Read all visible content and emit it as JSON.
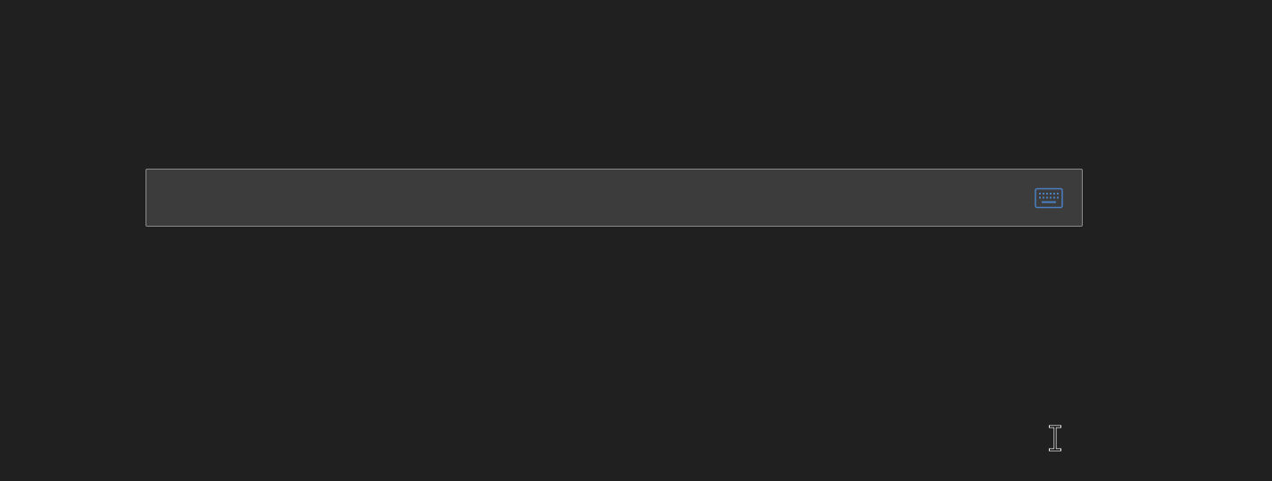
{
  "search": {
    "value": "",
    "placeholder": ""
  },
  "icons": {
    "keyboard": "keyboard-icon",
    "cursor": "text-cursor-icon"
  },
  "colors": {
    "background": "#202020",
    "input_background": "#3c3c3c",
    "input_border": "#8a8a8a",
    "accent": "#4a7fc1"
  }
}
